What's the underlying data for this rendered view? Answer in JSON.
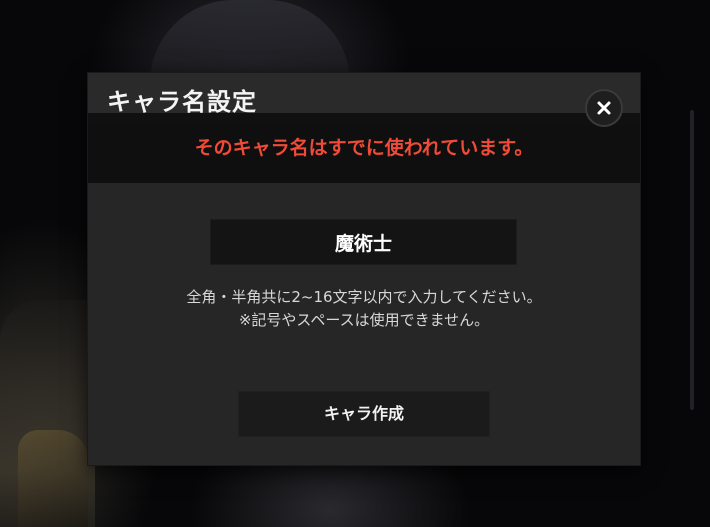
{
  "dialog": {
    "title": "キャラ名設定",
    "close_icon": "close-icon",
    "error_message": "そのキャラ名はすでに使われています。",
    "error_color": "#f04b38",
    "name_input": {
      "value": "魔術士"
    },
    "hint_lines": [
      "全角・半角共に2~16文字以内で入力してください。",
      "※記号やスペースは使用できません。"
    ],
    "create_button_label": "キャラ作成"
  }
}
